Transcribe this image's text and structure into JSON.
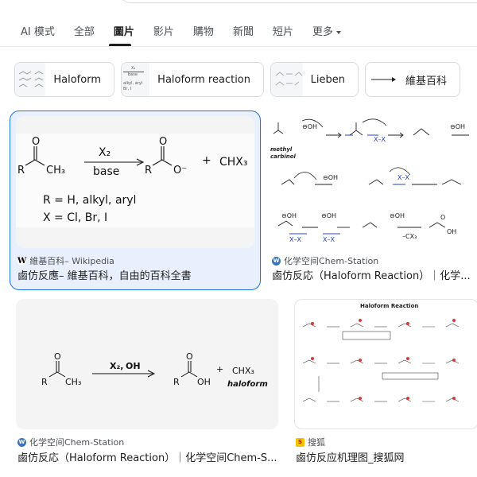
{
  "tabs": [
    {
      "label": "AI 模式",
      "active": false
    },
    {
      "label": "全部",
      "active": false
    },
    {
      "label": "圖片",
      "active": true
    },
    {
      "label": "影片",
      "active": false
    },
    {
      "label": "購物",
      "active": false
    },
    {
      "label": "新聞",
      "active": false
    },
    {
      "label": "短片",
      "active": false
    },
    {
      "label": "更多",
      "active": false
    }
  ],
  "chips": [
    {
      "label": "Haloform"
    },
    {
      "label": "Haloform reaction",
      "thumb_text": [
        "X₂",
        "base",
        "alkyl, aryl",
        "Br, I"
      ]
    },
    {
      "label": "Lieben"
    },
    {
      "label": "維基百科"
    }
  ],
  "results": [
    {
      "source": "維基百科– Wikipedia",
      "favicon": "W",
      "title": "鹵仿反應– 維基百科，自由的百科全書",
      "image_text": {
        "reagent": "X₂",
        "condition": "base",
        "plus": "+",
        "product": "CHX₃",
        "line1": "R = H, alkyl, aryl",
        "line2": "X = Cl, Br, I"
      }
    },
    {
      "source": "化学空间Chem-Station",
      "favicon": "W",
      "title": "鹵仿反応（Haloform Reaction）｜化学...",
      "image_text": {
        "label_methyl": "methyl",
        "label_carbinol": "carbinol"
      }
    },
    {
      "source": "化学空间Chem-Station",
      "favicon": "W",
      "title": "鹵仿反応（Haloform Reaction）｜化学空间Chem-S...",
      "image_text": {
        "reagent": "X₂,",
        "reagent_oh": "OH",
        "plus": "+",
        "product": "CHX₃",
        "product_name": "haloform"
      }
    },
    {
      "source": "搜狐",
      "favicon": "S",
      "title": "鹵仿反应机理图_搜狐网",
      "image_text": {
        "heading": "Haloform Reaction"
      }
    }
  ]
}
